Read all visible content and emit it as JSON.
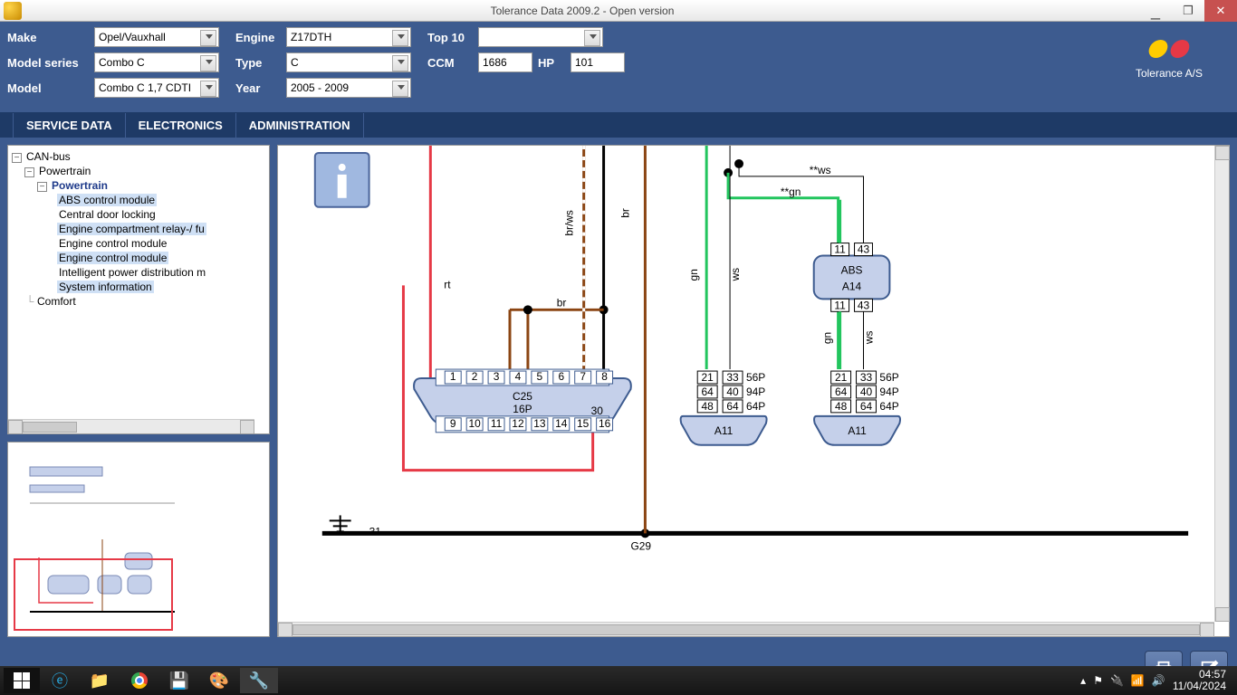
{
  "window": {
    "title": "Tolerance Data 2009.2 - Open version"
  },
  "header": {
    "labels": {
      "make": "Make",
      "model_series": "Model series",
      "model": "Model",
      "engine": "Engine",
      "type": "Type",
      "year": "Year",
      "top10": "Top 10",
      "ccm": "CCM",
      "hp": "HP"
    },
    "values": {
      "make": "Opel/Vauxhall",
      "model_series": "Combo C",
      "model": "Combo C 1,7 CDTI",
      "engine": "Z17DTH",
      "type": "C",
      "year": "2005 - 2009",
      "top10": "",
      "ccm": "1686",
      "hp": "101"
    },
    "brand": "Tolerance A/S"
  },
  "tabs": {
    "service": "SERVICE DATA",
    "electronics": "ELECTRONICS",
    "admin": "ADMINISTRATION"
  },
  "tree": {
    "root": "CAN-bus",
    "powertrain": "Powertrain",
    "powertrain_bold": "Powertrain",
    "items": [
      "ABS control module",
      "Central door locking",
      "Engine compartment relay-/ fu",
      "Engine control module",
      "Engine control module",
      "Intelligent power distribution m",
      "System information"
    ],
    "comfort": "Comfort"
  },
  "diagram": {
    "ground_label": "31",
    "ground_node": "G29",
    "connector": {
      "name": "C25",
      "pins": "16P",
      "pin30": "30"
    },
    "abs": {
      "name": "ABS",
      "id": "A14"
    },
    "a11": "A11",
    "wire_labels": {
      "rt": "rt",
      "br": "br",
      "brws": "br/ws",
      "gn": "gn",
      "ws": "ws",
      "star_ws": "**ws",
      "star_gn": "**gn"
    },
    "pins_top": [
      "1",
      "2",
      "3",
      "4",
      "5",
      "6",
      "7",
      "8"
    ],
    "pins_bot": [
      "9",
      "10",
      "11",
      "12",
      "13",
      "14",
      "15",
      "16"
    ],
    "abs_pins": [
      "11",
      "43"
    ],
    "a11_rows": [
      [
        "21",
        "33",
        "56P"
      ],
      [
        "64",
        "40",
        "94P"
      ],
      [
        "48",
        "64",
        "64P"
      ]
    ]
  },
  "taskbar": {
    "time": "04:57",
    "date": "11/04/2024"
  }
}
